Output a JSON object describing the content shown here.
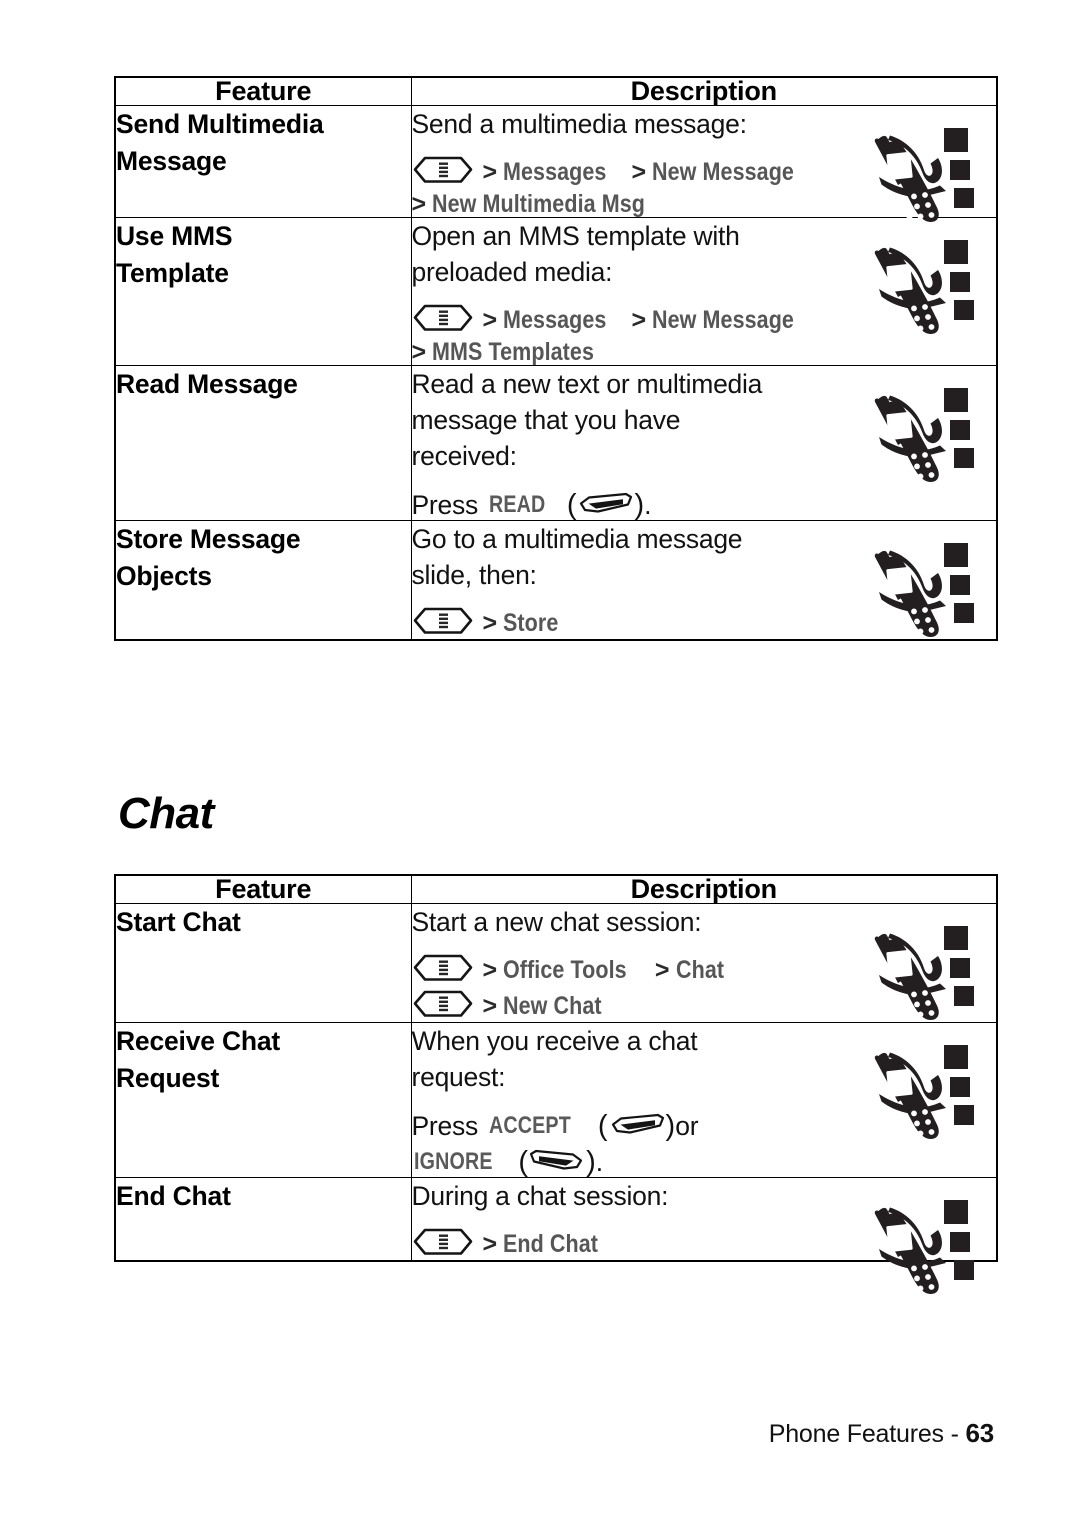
{
  "page": {
    "footer_label": "Phone Features -",
    "page_number": "63"
  },
  "section_heading": "Chat",
  "colors": {
    "menu_path_gray": "#565656",
    "softkey_label_gray": "#5a5a5a",
    "rule": "#000000",
    "text": "#121212"
  },
  "tables": [
    {
      "id": "messaging-table",
      "headers": {
        "feature": "Feature",
        "description": "Description"
      },
      "rows": [
        {
          "feature": [
            "Send Multimedia",
            "Message"
          ],
          "description_lines": [
            "Send a multimedia message:"
          ],
          "paths": [
            {
              "lead_icon": "menu-key-icon",
              "segments": [
                "Messages",
                "New Message"
              ]
            },
            {
              "lead_icon": "",
              "segments": [
                "New Multimedia Msg"
              ]
            }
          ],
          "press": null,
          "icon": "mms-phone-icon"
        },
        {
          "feature": [
            "Use MMS",
            "Template"
          ],
          "description_lines": [
            "Open an MMS template with",
            "preloaded media:"
          ],
          "paths": [
            {
              "lead_icon": "menu-key-icon",
              "segments": [
                "Messages",
                "New Message"
              ]
            },
            {
              "lead_icon": "",
              "segments": [
                "MMS Templates"
              ]
            }
          ],
          "press": null,
          "icon": "mms-phone-icon"
        },
        {
          "feature": [
            "Read Message"
          ],
          "description_lines": [
            "Read a new text or multimedia",
            "message that you have",
            "received:"
          ],
          "paths": [],
          "press": {
            "prefix": "Press",
            "keys": [
              {
                "label": "READ",
                "key_icon": "left-softkey-icon",
                "suffix": "."
              }
            ]
          },
          "icon": "mms-phone-icon"
        },
        {
          "feature": [
            "Store Message",
            "Objects"
          ],
          "description_lines": [
            "Go to a multimedia message",
            "slide, then:"
          ],
          "paths": [
            {
              "lead_icon": "menu-key-icon",
              "segments": [
                "Store"
              ]
            }
          ],
          "press": null,
          "icon": "mms-phone-icon"
        }
      ]
    },
    {
      "id": "chat-table",
      "headers": {
        "feature": "Feature",
        "description": "Description"
      },
      "rows": [
        {
          "feature": [
            "Start Chat"
          ],
          "description_lines": [
            "Start a new chat session:"
          ],
          "paths": [
            {
              "lead_icon": "menu-key-icon",
              "segments": [
                "Office Tools",
                "Chat"
              ]
            },
            {
              "lead_icon": "menu-key-icon",
              "segments": [
                "New Chat"
              ]
            }
          ],
          "press": null,
          "icon": "mms-phone-icon"
        },
        {
          "feature": [
            "Receive Chat",
            "Request"
          ],
          "description_lines": [
            "When you receive a chat",
            "request:"
          ],
          "paths": [],
          "press": {
            "prefix": "Press",
            "keys": [
              {
                "label": "ACCEPT",
                "key_icon": "left-softkey-icon",
                "suffix": " or"
              },
              {
                "label": "IGNORE",
                "key_icon": "right-softkey-icon",
                "suffix": "."
              }
            ]
          },
          "icon": "mms-phone-icon"
        },
        {
          "feature": [
            "End Chat"
          ],
          "description_lines": [
            "During a chat session:"
          ],
          "paths": [
            {
              "lead_icon": "menu-key-icon",
              "segments": [
                "End Chat"
              ]
            }
          ],
          "press": null,
          "icon": "mms-phone-icon"
        }
      ]
    }
  ],
  "icon_names": {
    "menu_key": "menu-key-icon",
    "left_softkey": "left-softkey-icon",
    "right_softkey": "right-softkey-icon",
    "phone": "mms-phone-icon"
  }
}
